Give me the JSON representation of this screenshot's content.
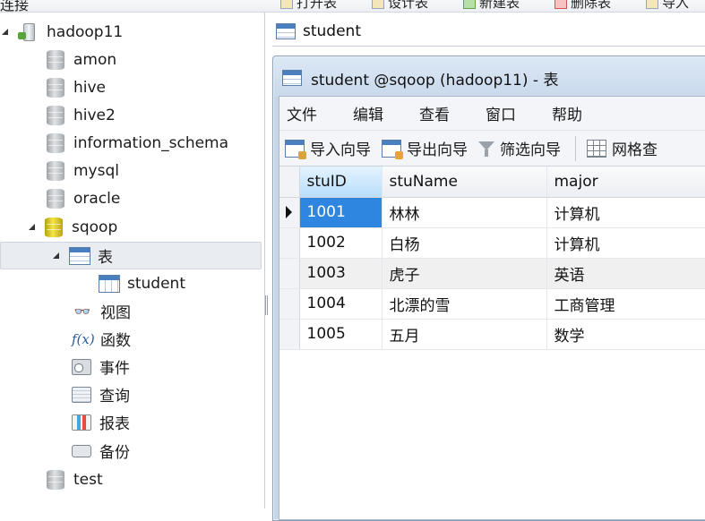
{
  "top_toolbar": {
    "connection_label": "连接",
    "buttons": [
      {
        "label": "打开表",
        "icon": "open-table-icon"
      },
      {
        "label": "设计表",
        "icon": "design-table-icon"
      },
      {
        "label": "新建表",
        "icon": "new-table-icon"
      },
      {
        "label": "删除表",
        "icon": "delete-table-icon"
      },
      {
        "label": "导入",
        "icon": "import-icon"
      }
    ]
  },
  "tree": {
    "connection": "hadoop11",
    "databases": [
      "amon",
      "hive",
      "hive2",
      "information_schema",
      "mysql",
      "oracle"
    ],
    "open_database": "sqoop",
    "tables_folder": "表",
    "table": "student",
    "objects": [
      {
        "label": "视图",
        "icon": "view-icon"
      },
      {
        "label": "函数",
        "icon": "function-icon"
      },
      {
        "label": "事件",
        "icon": "event-icon"
      },
      {
        "label": "查询",
        "icon": "query-icon"
      },
      {
        "label": "报表",
        "icon": "report-icon"
      },
      {
        "label": "备份",
        "icon": "backup-icon"
      }
    ],
    "last_database": "test"
  },
  "object_tab": {
    "label": "student"
  },
  "table_window": {
    "title": "student @sqoop (hadoop11) - 表",
    "menu": [
      "文件",
      "编辑",
      "查看",
      "窗口",
      "帮助"
    ],
    "toolbar": {
      "import_wizard": "导入向导",
      "export_wizard": "导出向导",
      "filter_wizard": "筛选向导",
      "grid_view": "网格查"
    },
    "columns": [
      "stuID",
      "stuName",
      "major"
    ],
    "rows": [
      [
        "1001",
        "林林",
        "计算机"
      ],
      [
        "1002",
        "白杨",
        "计算机"
      ],
      [
        "1003",
        "虎子",
        "英语"
      ],
      [
        "1004",
        "北漂的雪",
        "工商管理"
      ],
      [
        "1005",
        "五月",
        "数学"
      ]
    ]
  }
}
